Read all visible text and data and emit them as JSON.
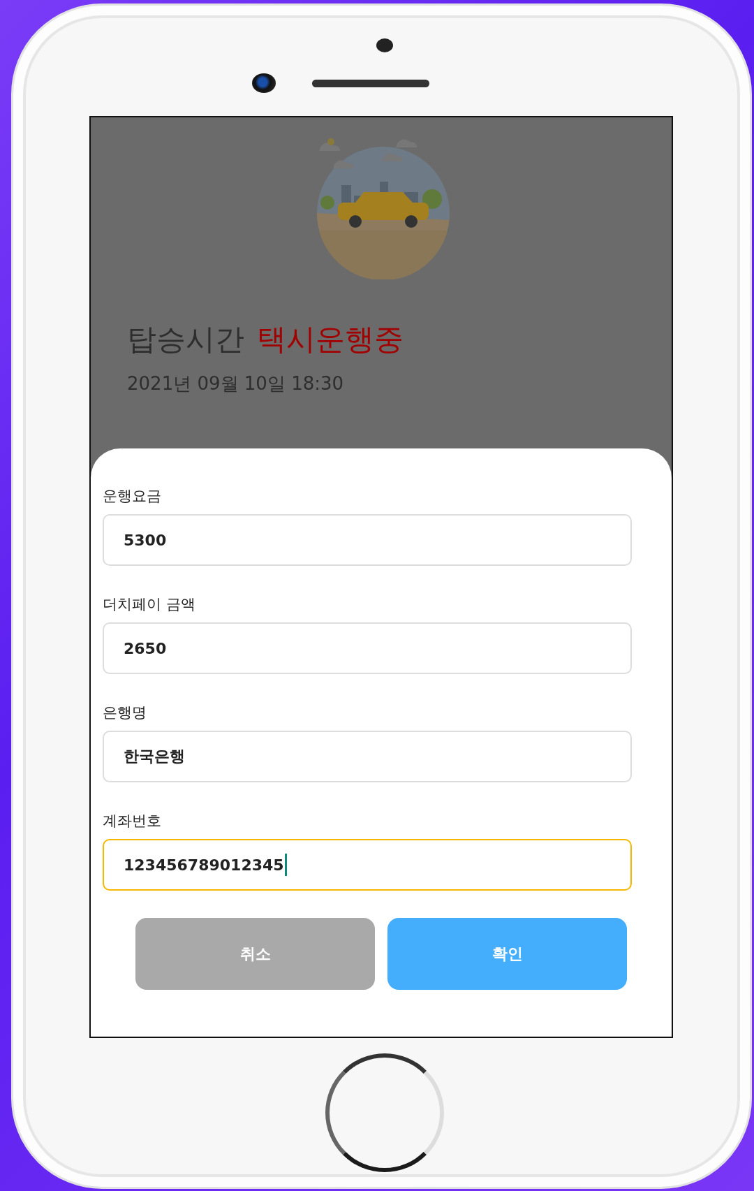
{
  "header": {
    "title": "탑승시간",
    "status": "택시운행중",
    "datetime": "2021년 09월 10일 18:30"
  },
  "fields": [
    {
      "label": "운행요금",
      "value": "5300",
      "focused": false
    },
    {
      "label": "더치페이 금액",
      "value": "2650",
      "focused": false
    },
    {
      "label": "은행명",
      "value": "한국은행",
      "focused": false
    },
    {
      "label": "계좌번호",
      "value": "123456789012345",
      "focused": true
    }
  ],
  "buttons": [
    {
      "label": "취소",
      "kind": "cancel"
    },
    {
      "label": "확인",
      "kind": "confirm"
    }
  ]
}
